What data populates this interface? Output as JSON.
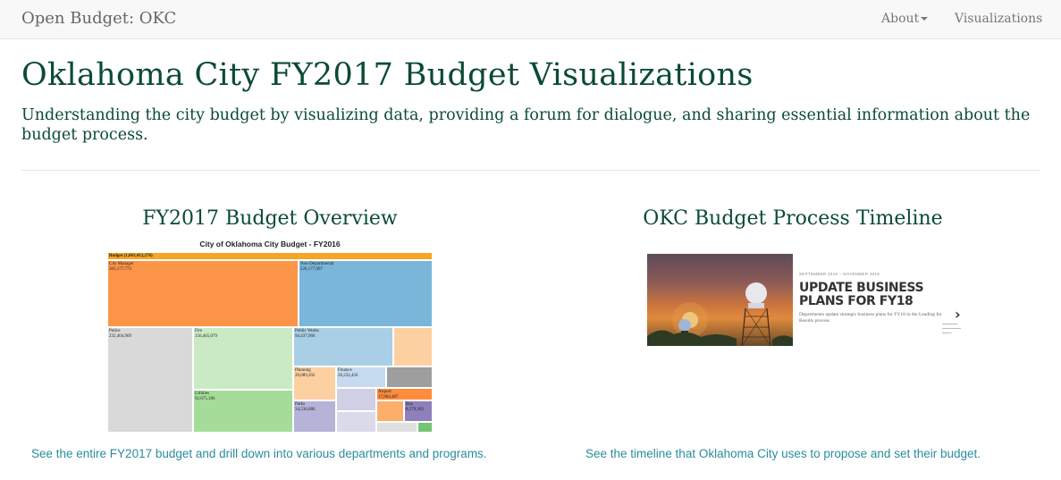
{
  "navbar": {
    "brand": "Open Budget: OKC",
    "items": [
      {
        "label": "About",
        "dropdown": true
      },
      {
        "label": "Visualizations"
      }
    ]
  },
  "header": {
    "title": "Oklahoma City FY2017 Budget Visualizations",
    "lead": "Understanding the city budget by visualizing data, providing a forum for dialogue, and sharing essential information about the budget process."
  },
  "cards": [
    {
      "title": "FY2017 Budget Overview",
      "link": "See the entire FY2017 budget and drill down into various departments and programs."
    },
    {
      "title": "OKC Budget Process Timeline",
      "link": "See the timeline that Oklahoma City uses to propose and set their budget."
    }
  ],
  "treemap": {
    "title": "City of Oklahoma City Budget - FY2016",
    "root_label": "Budget (1,063,412,276)",
    "nodes": [
      {
        "name": "City Manager",
        "value": "303,177,772",
        "color": "#fd9549"
      },
      {
        "name": "Non-Departmental",
        "value": "226,177,097",
        "color": "#7ab6da"
      },
      {
        "name": "Police",
        "value": "232,404,969",
        "color": "#d9d9d9"
      },
      {
        "name": "Fire",
        "value": "156,465,079",
        "color": "#caeac3"
      },
      {
        "name": "Public Works",
        "value": "94,437,966",
        "color": "#a9cfe6"
      },
      {
        "name": "Utilities",
        "value": "92,675,186",
        "color": "#a6dc9a"
      },
      {
        "name": "Planning",
        "value": "20,089,202",
        "color": "#fdd0a2"
      },
      {
        "name": "Finance",
        "value": "26,232,456",
        "color": "#c6dbef"
      },
      {
        "name": "Airport",
        "value": "17,864,487",
        "color": "#fd8c3c"
      },
      {
        "name": "Parks",
        "value": "34,536,086",
        "color": "#b5b3d8"
      },
      {
        "name": "Bus",
        "value": "8,279,303",
        "color": "#8d80bb"
      }
    ],
    "extra_colors": [
      "#fdd0a2",
      "#9e9e9e",
      "#d0d0e6",
      "#dadaeb",
      "#fdae6b",
      "#e0e0e0",
      "#74c476"
    ]
  },
  "timeline": {
    "date": "SEPTEMBER 2016 – NOVEMBER 2016",
    "heading": "UPDATE BUSINESS PLANS FOR FY18",
    "description": "Departments update strategic business plans for FY18 in the Leading for Results process",
    "next_icon": "chevron-right-icon"
  }
}
